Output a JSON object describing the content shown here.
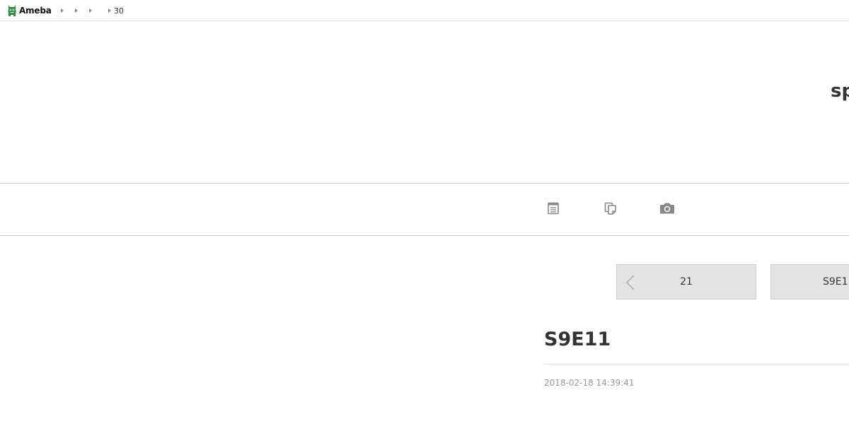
{
  "topbar": {
    "logo_text": "Ameba",
    "breadcrumbs": [
      "",
      "",
      "",
      "30"
    ]
  },
  "header": {
    "blog_title": "sp"
  },
  "menu": {
    "icons": [
      "entry-list-icon",
      "copy-icon",
      "camera-icon"
    ]
  },
  "pager": {
    "prev_label": "21",
    "next_label": "S9E1"
  },
  "entry": {
    "title": "S9E11",
    "date": "2018-02-18 14:39:41"
  },
  "colors": {
    "logo_green": "#2d8c3c",
    "icon_gray": "#888888",
    "text": "#333333",
    "muted": "#999999",
    "button_bg": "#e4e4e4"
  }
}
